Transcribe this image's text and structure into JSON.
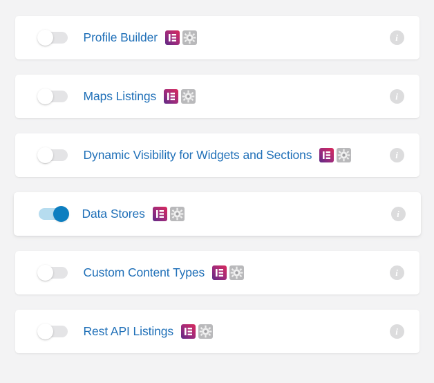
{
  "theme": {
    "page_background": "#f3f3f4",
    "card_background": "#ffffff",
    "label_color": "#2070b8",
    "toggle_off_track": "#e4e4e6",
    "toggle_off_knob": "#ffffff",
    "toggle_on_track": "#b6dcef",
    "toggle_on_knob": "#0d7ec0",
    "info_icon_color": "#dcdcdd",
    "elementor_gradient_start": "#6b2d8e",
    "elementor_gradient_end": "#d4285c",
    "gear_badge_color": "#a9a9ab"
  },
  "info_glyph": "i",
  "rows": [
    {
      "label": "Profile Builder",
      "enabled": false,
      "toggle_state": "off",
      "badges": [
        "elementor-icon",
        "gear-badge-icon"
      ],
      "info": "i"
    },
    {
      "label": "Maps Listings",
      "enabled": false,
      "toggle_state": "off",
      "badges": [
        "elementor-icon",
        "gear-badge-icon"
      ],
      "info": "i"
    },
    {
      "label": "Dynamic Visibility for Widgets and Sections",
      "enabled": false,
      "toggle_state": "off",
      "badges": [
        "elementor-icon",
        "gear-badge-icon"
      ],
      "info": "i"
    },
    {
      "label": "Data Stores",
      "enabled": true,
      "toggle_state": "on",
      "badges": [
        "elementor-icon",
        "gear-badge-icon"
      ],
      "info": "i"
    },
    {
      "label": "Custom Content Types",
      "enabled": false,
      "toggle_state": "off",
      "badges": [
        "elementor-icon",
        "gear-badge-icon"
      ],
      "info": "i"
    },
    {
      "label": "Rest API Listings",
      "enabled": false,
      "toggle_state": "off",
      "badges": [
        "elementor-icon",
        "gear-badge-icon"
      ],
      "info": "i"
    }
  ]
}
